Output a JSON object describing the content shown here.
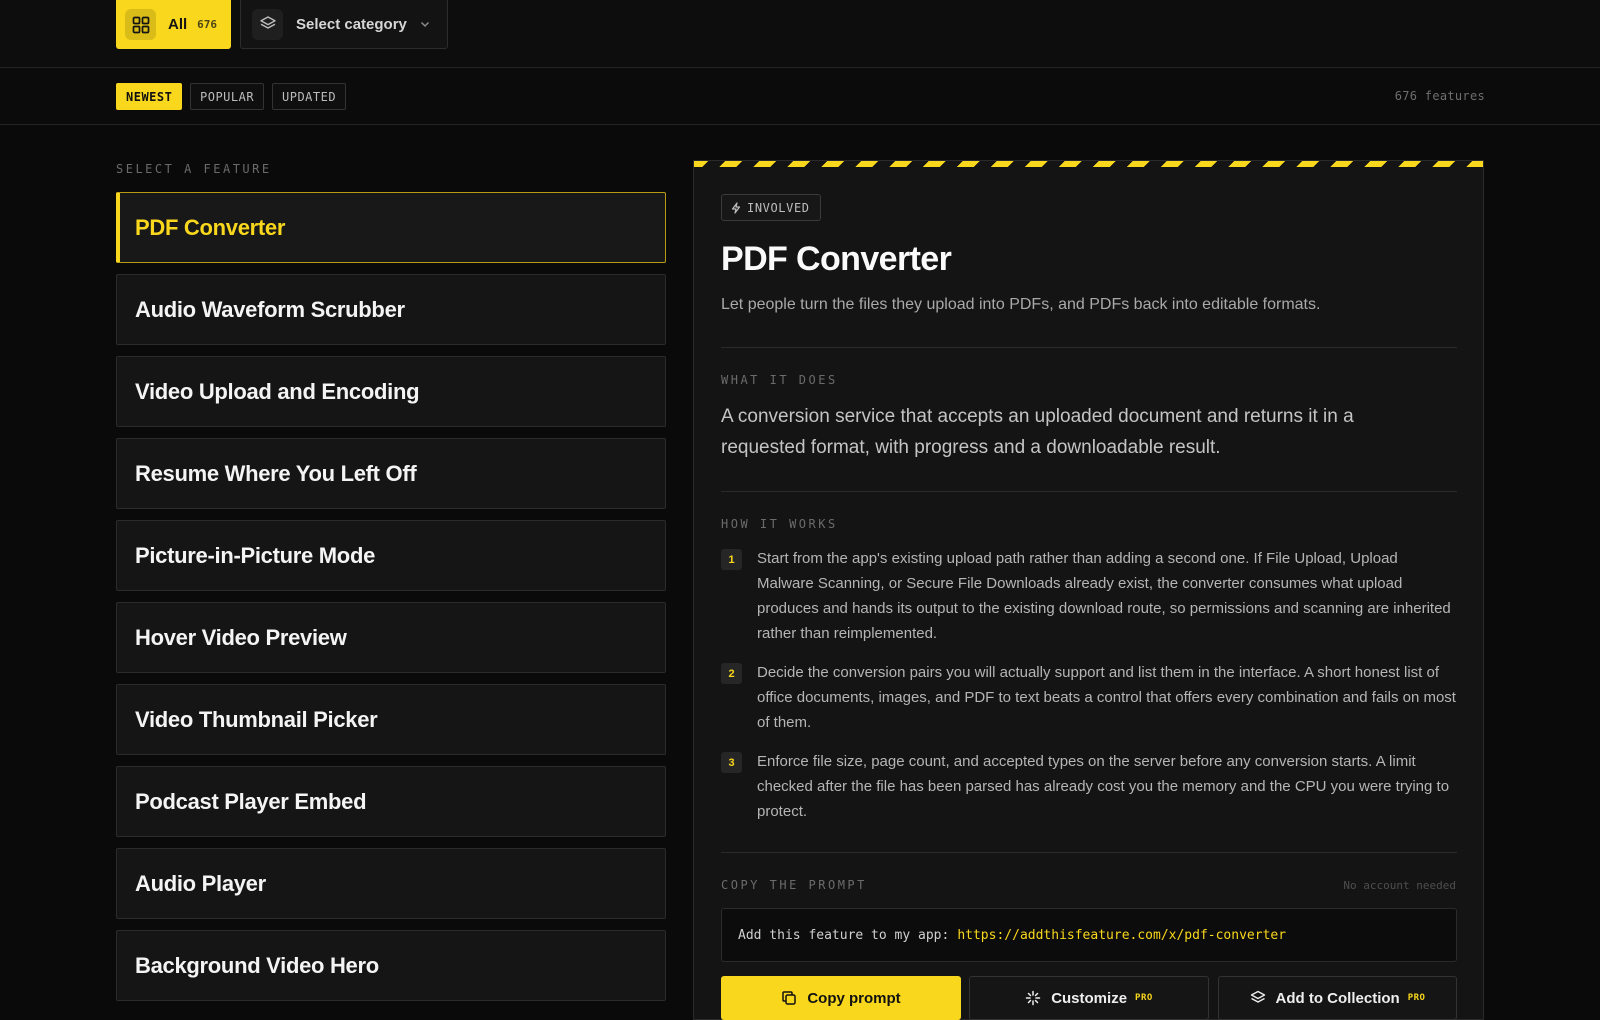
{
  "topbar": {
    "all_label": "All",
    "all_count": "676",
    "category_placeholder": "Select category"
  },
  "filters": {
    "chips": [
      "NEWEST",
      "POPULAR",
      "UPDATED"
    ],
    "active": "NEWEST",
    "count_text": "676 features"
  },
  "list": {
    "title": "SELECT A FEATURE",
    "items": [
      "PDF Converter",
      "Audio Waveform Scrubber",
      "Video Upload and Encoding",
      "Resume Where You Left Off",
      "Picture-in-Picture Mode",
      "Hover Video Preview",
      "Video Thumbnail Picker",
      "Podcast Player Embed",
      "Audio Player",
      "Background Video Hero"
    ],
    "selected": "PDF Converter"
  },
  "detail": {
    "badge": "INVOLVED",
    "title": "PDF Converter",
    "subtitle": "Let people turn the files they upload into PDFs, and PDFs back into editable formats.",
    "what_label": "WHAT IT DOES",
    "what_text": "A conversion service that accepts an uploaded document and returns it in a requested format, with progress and a downloadable result.",
    "how_label": "HOW IT WORKS",
    "steps": [
      {
        "num": "1",
        "text": "Start from the app's existing upload path rather than adding a second one. If File Upload, Upload Malware Scanning, or Secure File Downloads already exist, the converter consumes what upload produces and hands its output to the existing download route, so permissions and scanning are inherited rather than reimplemented."
      },
      {
        "num": "2",
        "text": "Decide the conversion pairs you will actually support and list them in the interface. A short honest list of office documents, images, and PDF to text beats a control that offers every combination and fails on most of them."
      },
      {
        "num": "3",
        "text": "Enforce file size, page count, and accepted types on the server before any conversion starts. A limit checked after the file has been parsed has already cost you the memory and the CPU you were trying to protect."
      }
    ],
    "copy_label": "COPY THE PROMPT",
    "no_account": "No account needed",
    "prompt_prefix": "Add this feature to my app:",
    "prompt_url": "https://addthisfeature.com/x/pdf-converter",
    "buttons": {
      "copy": "Copy prompt",
      "customize": "Customize",
      "collection": "Add to Collection",
      "pro": "PRO"
    }
  },
  "colors": {
    "accent": "#f9d71c",
    "background": "#0a0a0a",
    "panel": "#141414"
  }
}
